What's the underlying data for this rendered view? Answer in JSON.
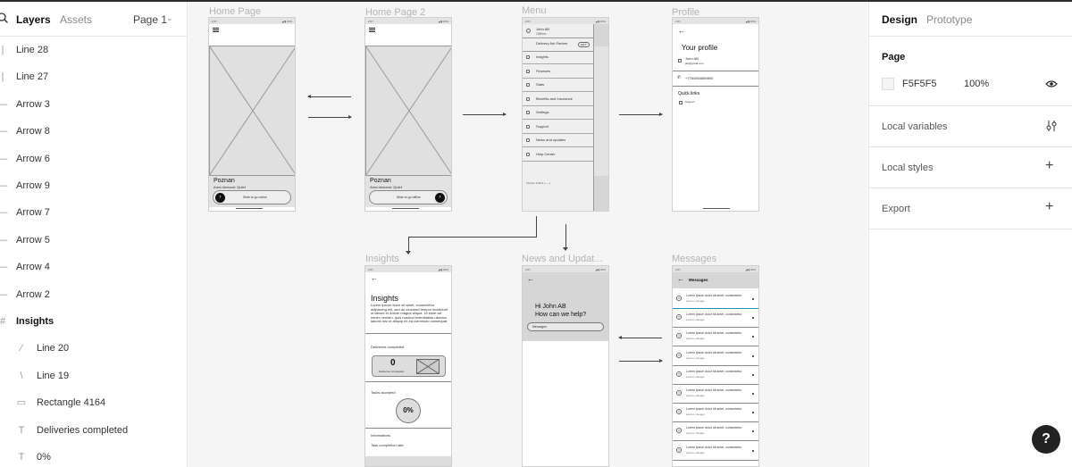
{
  "left_panel": {
    "tabs": {
      "layers": "Layers",
      "assets": "Assets"
    },
    "page_selector": "Page 1",
    "layers": [
      {
        "label": "Line 28",
        "icon": "line-icon"
      },
      {
        "label": "Line 27",
        "icon": "line-icon"
      },
      {
        "label": "Arrow 3",
        "icon": "arrow-icon"
      },
      {
        "label": "Arrow 8",
        "icon": "arrow-icon"
      },
      {
        "label": "Arrow 6",
        "icon": "arrow-icon"
      },
      {
        "label": "Arrow 9",
        "icon": "arrow-icon"
      },
      {
        "label": "Arrow 7",
        "icon": "arrow-icon"
      },
      {
        "label": "Arrow 5",
        "icon": "arrow-icon"
      },
      {
        "label": "Arrow 4",
        "icon": "arrow-icon"
      },
      {
        "label": "Arrow 2",
        "icon": "arrow-icon"
      },
      {
        "label": "Insights",
        "icon": "frame-icon"
      },
      {
        "label": "Line 20",
        "icon": "line-icon"
      },
      {
        "label": "Line 19",
        "icon": "line-icon"
      },
      {
        "label": "Rectangle 4164",
        "icon": "rectangle-icon"
      },
      {
        "label": "Deliveries completed",
        "icon": "text-icon"
      },
      {
        "label": "0%",
        "icon": "text-icon"
      }
    ]
  },
  "canvas": {
    "frames": {
      "home": {
        "label": "Home Page",
        "city": "Poznan",
        "demand": "Area demand: Quiet",
        "slider": "Slide to go online"
      },
      "home2": {
        "label": "Home Page 2",
        "city": "Poznan",
        "demand": "Area demand: Quiet",
        "slider": "Slide to go offline"
      },
      "menu": {
        "label": "Menu",
        "user_name": "John AB",
        "user_status": "Offline",
        "delivery_partner": "Delivery Ant Partner",
        "badge": "EDIT",
        "items": [
          "Insights",
          "Finances",
          "Stats",
          "Benefits and Insurance",
          "Settings",
          "Support",
          "News and updates",
          "Help Center"
        ],
        "version": "Version 2.90.2 (-----)"
      },
      "profile": {
        "label": "Profile",
        "title": "Your profile",
        "name": "John AB",
        "email": "jab@gmail.com",
        "phone": "+7784564689800",
        "quick_links": "Quick links",
        "link1": "Support"
      },
      "insights": {
        "label": "Insights",
        "title": "Insights",
        "body": "Lorem ipsum dolor sit amet, consectetur adipiscing elit, sed do eiusmod tempor incididunt ut labore et dolore magna aliqua. Ut enim ad minim veniam, quis nostrud exercitation ullamco laboris nisi ut aliquip ex ea commodo consequat.",
        "deliveries_heading": "Deliveries completed",
        "deliveries_value": "0",
        "deliveries_caption": "Deliveries completed",
        "tasks_heading": "Tasks accepted",
        "percent": "0%",
        "informations": "Informations",
        "task_rate": "Task completion rate"
      },
      "news": {
        "label": "News and Updat...",
        "greeting": "Hi John AB",
        "question": "How can we help?",
        "search": "Messages"
      },
      "messages": {
        "label": "Messages",
        "title": "Messages",
        "item_text": "Lorem ipsum dolor sit amet, consectetur",
        "item_meta": "Lorem  •  2a ago",
        "item_count": 9
      }
    }
  },
  "right_panel": {
    "tabs": {
      "design": "Design",
      "prototype": "Prototype"
    },
    "page_heading": "Page",
    "page_color": "F5F5F5",
    "page_color_hex": "#f5f5f5",
    "page_opacity": "100%",
    "sections": [
      "Local variables",
      "Local styles",
      "Export"
    ]
  },
  "help_button": "?"
}
